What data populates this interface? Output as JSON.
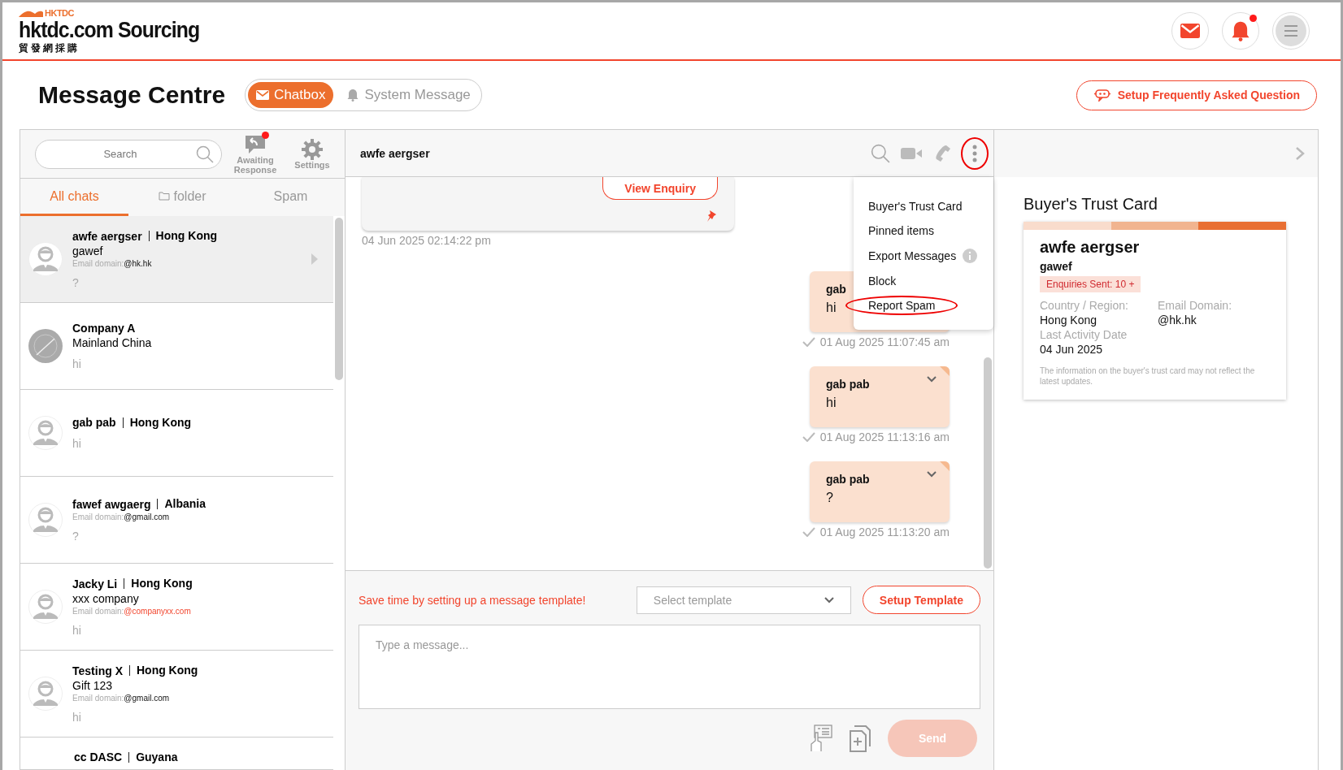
{
  "brand": {
    "mark": "HKTDC",
    "name": "hktdc.com Sourcing",
    "name_zh": "貿發網採購"
  },
  "header_buttons": [
    {
      "kind": "mail",
      "badge": false
    },
    {
      "kind": "bell",
      "badge": true
    },
    {
      "kind": "menu",
      "badge": false
    }
  ],
  "page_title": "Message Centre",
  "mode_tabs": [
    {
      "label": "Chatbox",
      "kind": "mail",
      "selected": true
    },
    {
      "label": "System Message",
      "kind": "bell",
      "selected": false
    }
  ],
  "faq_button": "Setup Frequently Asked Question",
  "sidebar": {
    "search": {
      "placeholder": "Search"
    },
    "tools": [
      {
        "label": "Awaiting Response",
        "kind": "reply",
        "badge": true
      },
      {
        "label": "Settings",
        "kind": "gear",
        "badge": false
      }
    ],
    "tabs": [
      {
        "label": "All chats",
        "folder": false,
        "selected": true
      },
      {
        "label": "folder",
        "folder": true,
        "selected": false
      },
      {
        "label": "Spam",
        "folder": false,
        "selected": false
      }
    ],
    "chats": [
      {
        "kind": "person",
        "name": "awfe aergser",
        "region": "Hong Kong",
        "company": "gawef",
        "email_label": "Email domain:",
        "email": "@hk.hk",
        "email_flagged": false,
        "preview": "?",
        "selected": true
      },
      {
        "kind": "globe",
        "name": "Company A",
        "company": "Mainland China",
        "preview": "hi",
        "selected": false
      },
      {
        "kind": "person",
        "name": "gab pab",
        "region": "Hong Kong",
        "preview": "hi",
        "selected": false
      },
      {
        "kind": "person",
        "name": "fawef awgaerg",
        "region": "Albania",
        "email_label": "Email domain:",
        "email": "@gmail.com",
        "email_flagged": false,
        "preview": "?",
        "selected": false
      },
      {
        "kind": "person",
        "name": "Jacky Li",
        "region": "Hong Kong",
        "company": "xxx company",
        "email_label": "Email domain:",
        "email": "@companyxx.com",
        "email_flagged": true,
        "preview": "hi",
        "selected": false
      },
      {
        "kind": "person",
        "name": "Testing X",
        "region": "Hong Kong",
        "company": "Gift 123",
        "email_label": "Email domain:",
        "email": "@gmail.com",
        "email_flagged": false,
        "preview": "hi",
        "selected": false
      },
      {
        "kind": "cut",
        "name": "cc DASC",
        "region": "Guyana",
        "selected": false
      }
    ]
  },
  "chat": {
    "title": "awfe aergser",
    "actions": [
      {
        "kind": "search",
        "highlighted": false
      },
      {
        "kind": "video",
        "highlighted": false
      },
      {
        "kind": "phone",
        "highlighted": false
      },
      {
        "kind": "more",
        "highlighted": true
      }
    ],
    "messages": [
      {
        "kind": "enquiry",
        "button": "View Enquiry",
        "pinned": true,
        "time": "04 Jun 2025 02:14:22 pm",
        "tick": false
      },
      {
        "kind": "bubble",
        "sender": "gab",
        "text": "hi",
        "time": "01 Aug 2025 11:07:45 am",
        "tick": true,
        "menu_caret": false
      },
      {
        "kind": "bubble",
        "sender": "gab pab",
        "text": "hi",
        "time": "01 Aug 2025 11:13:16 am",
        "tick": true,
        "menu_caret": true
      },
      {
        "kind": "bubble",
        "sender": "gab pab",
        "text": "?",
        "time": "01 Aug 2025 11:13:20 am",
        "tick": true,
        "menu_caret": true
      }
    ],
    "menu": [
      {
        "label": "Buyer's Trust Card",
        "info": false,
        "highlighted": false
      },
      {
        "label": "Pinned items",
        "info": false,
        "highlighted": false
      },
      {
        "label": "Export Messages",
        "info": true,
        "highlighted": false
      },
      {
        "label": "Block",
        "info": false,
        "highlighted": false
      },
      {
        "label": "Report Spam",
        "info": false,
        "highlighted": true
      }
    ],
    "template_hint": "Save time by setting up a message template!",
    "template_select": {
      "placeholder": "Select template"
    },
    "template_button": "Setup Template",
    "composer": {
      "placeholder": "Type a message..."
    },
    "send": {
      "label": "Send",
      "disabled": true
    }
  },
  "trust_card": {
    "title": "Buyer's Trust Card",
    "name": "awfe aergser",
    "company": "gawef",
    "badge": "Enquiries Sent: 10 +",
    "fields": [
      {
        "label": "Country / Region:",
        "value": "Hong Kong"
      },
      {
        "label": "Email Domain:",
        "value": "@hk.hk"
      },
      {
        "label": "Last Activity Date",
        "value": "04 Jun 2025"
      }
    ],
    "note": "The information on the buyer's trust card may not reflect the latest updates."
  }
}
